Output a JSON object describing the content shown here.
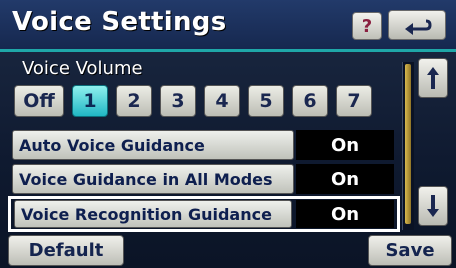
{
  "header": {
    "title": "Voice Settings",
    "help_label": "?"
  },
  "icons": {
    "back": "back-arrow-icon",
    "scroll_up": "up-arrow-icon",
    "scroll_down": "down-arrow-icon"
  },
  "voice_volume": {
    "label": "Voice Volume",
    "options": [
      "Off",
      "1",
      "2",
      "3",
      "4",
      "5",
      "6",
      "7"
    ],
    "selected": "1"
  },
  "settings": [
    {
      "label": "Auto Voice Guidance",
      "value": "On"
    },
    {
      "label": "Voice Guidance in All Modes",
      "value": "On"
    },
    {
      "label": "Voice Recognition Guidance",
      "value": "On"
    }
  ],
  "footer": {
    "default_label": "Default",
    "save_label": "Save"
  },
  "colors": {
    "accent": "#1fa7a8",
    "selected_volume": "#20b6c4",
    "scroll_thumb": "#d9b94d"
  }
}
